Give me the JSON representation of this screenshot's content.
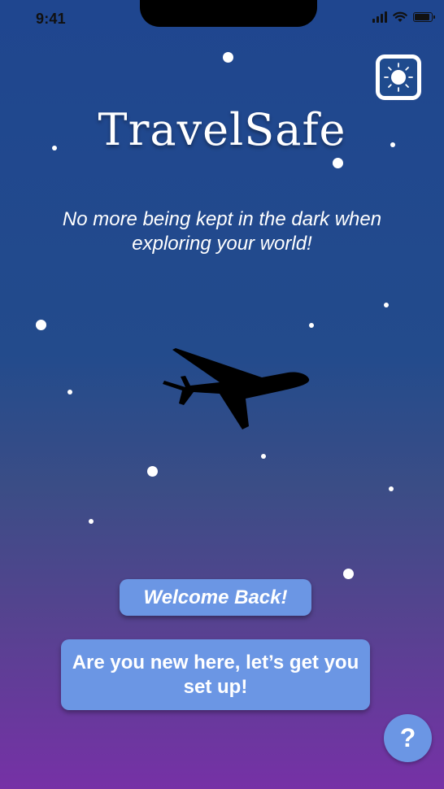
{
  "status_bar": {
    "time": "9:41"
  },
  "app": {
    "title": "TravelSafe",
    "tagline": "No more being kept in the dark when exploring your world!"
  },
  "buttons": {
    "welcome_back": "Welcome Back!",
    "new_user": "Are you new here, let’s get you set up!",
    "help": "?"
  },
  "icons": {
    "theme_toggle": "sun-icon",
    "hero": "airplane-icon",
    "signal": "cellular-signal-icon",
    "wifi": "wifi-icon",
    "battery": "battery-icon"
  },
  "colors": {
    "background_top": "#1f468f",
    "background_bottom": "#7631a6",
    "button": "#6b96e4",
    "text": "#ffffff"
  }
}
